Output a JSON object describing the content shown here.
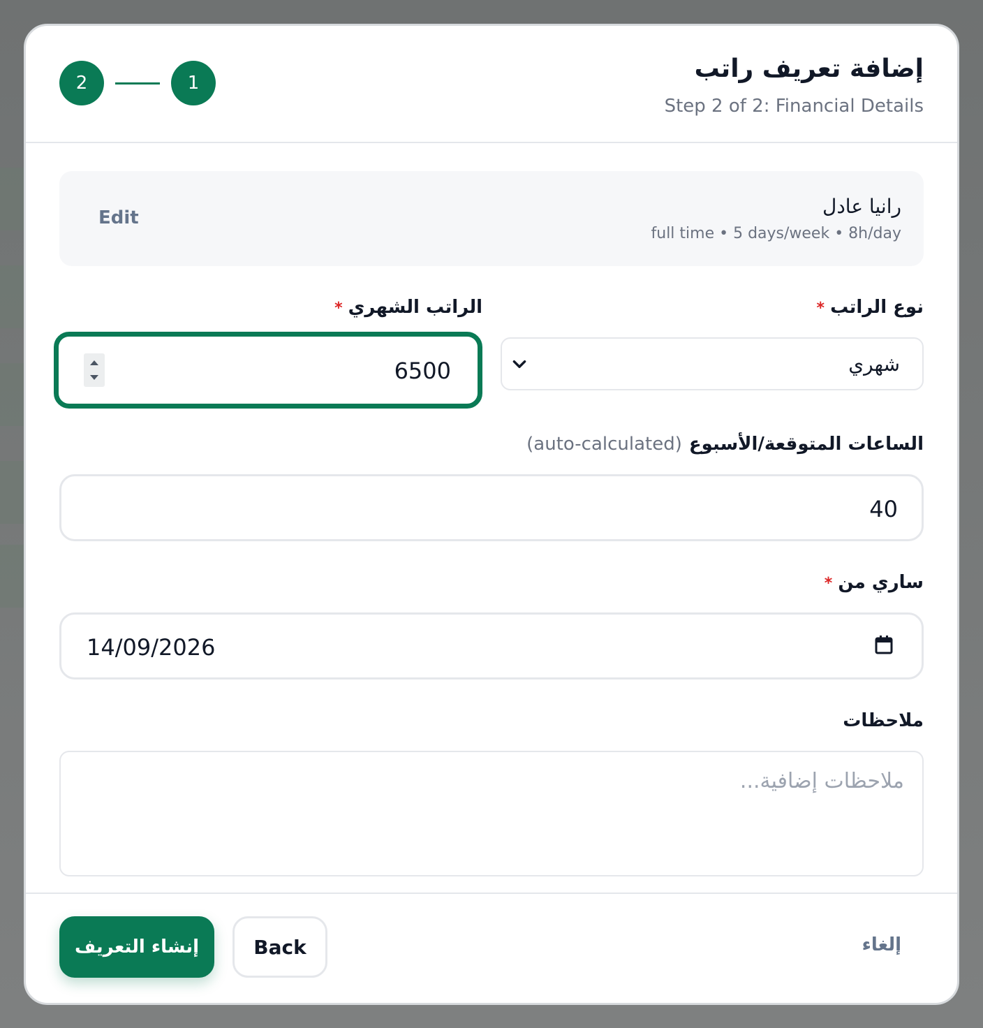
{
  "modal": {
    "title": "إضافة تعريف راتب",
    "subtitle": "Step 2 of 2: Financial Details",
    "steps": [
      "1",
      "2"
    ]
  },
  "summary": {
    "name": "رانيا عادل",
    "meta": "full time • 5 days/week • 8h/day",
    "edit_label": "Edit"
  },
  "form": {
    "salary_type": {
      "label": "نوع الراتب",
      "required_mark": "*",
      "value": "شهري"
    },
    "monthly_salary": {
      "label": "الراتب الشهري",
      "required_mark": "*",
      "value": "6500"
    },
    "expected_hours": {
      "label": "الساعات المتوقعة/الأسبوع",
      "hint": "(auto-calculated)",
      "value": "40"
    },
    "effective_from": {
      "label": "ساري من",
      "required_mark": "*",
      "value": "14/09/2026"
    },
    "notes": {
      "label": "ملاحظات",
      "placeholder": "ملاحظات إضافية..."
    }
  },
  "footer": {
    "create_label": "إنشاء التعريف",
    "back_label": "Back",
    "cancel_label": "إلغاء"
  },
  "colors": {
    "primary": "#0a7a55",
    "required": "#dc2626",
    "muted_text": "#6b7280"
  },
  "icons": {
    "select_chevron": "chevron-down-icon",
    "date_picker": "calendar-icon",
    "number_spinner": "spinner-arrows-icon"
  }
}
